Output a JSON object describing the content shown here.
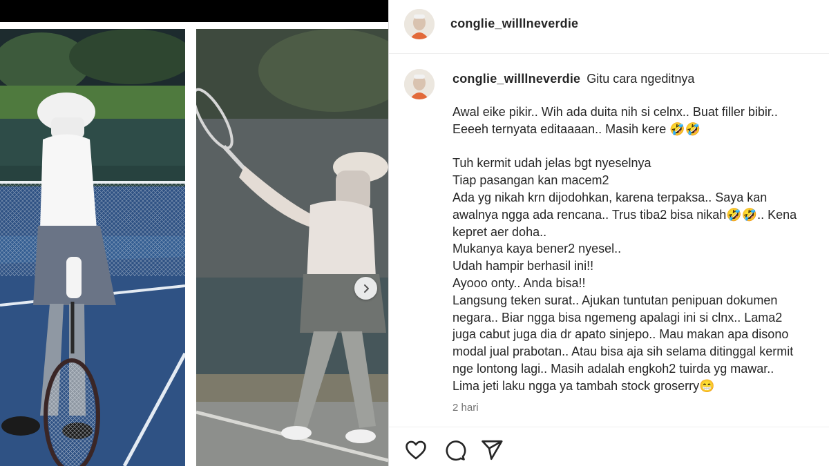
{
  "post": {
    "author": "conglie_willlneverdie",
    "caption": {
      "username": "conglie_willlneverdie",
      "headline": "Gitu cara ngeditnya",
      "body": "Awal eike pikir.. Wih ada duita nih si celnx.. Buat filler bibir..\nEeeeh ternyata editaaaan.. Masih kere 🤣🤣\n\nTuh kermit udah jelas bgt nyeselnya\nTiap pasangan kan macem2\nAda yg nikah krn dijodohkan, karena terpaksa.. Saya kan\nawalnya ngga ada rencana.. Trus tiba2 bisa nikah🤣🤣.. Kena\nkepret aer doha..\nMukanya kaya bener2 nyesel..\nUdah hampir berhasil ini!!\nAyooo onty.. Anda bisa!!\nLangsung teken surat.. Ajukan tuntutan penipuan dokumen\nnegara.. Biar ngga bisa ngemeng apalagi ini si clnx.. Lama2\njuga cabut juga dia dr apato sinjepo.. Mau makan apa disono\nmodal jual prabotan.. Atau bisa aja sih selama ditinggal kermit\nnge lontong lagi.. Masih adalah engkoh2 tuirda yg mawar..\nLima jeti laku ngga ya tambah stock groserry😁"
    },
    "timestamp": "2 hari"
  },
  "icons": {
    "like": "heart-icon",
    "comment": "speech-bubble-icon",
    "share": "paper-plane-icon",
    "next": "chevron-right-icon"
  },
  "colors": {
    "text": "#262626",
    "muted": "#737373",
    "divider": "#efefef",
    "court_blue": "#2c4a7a"
  }
}
